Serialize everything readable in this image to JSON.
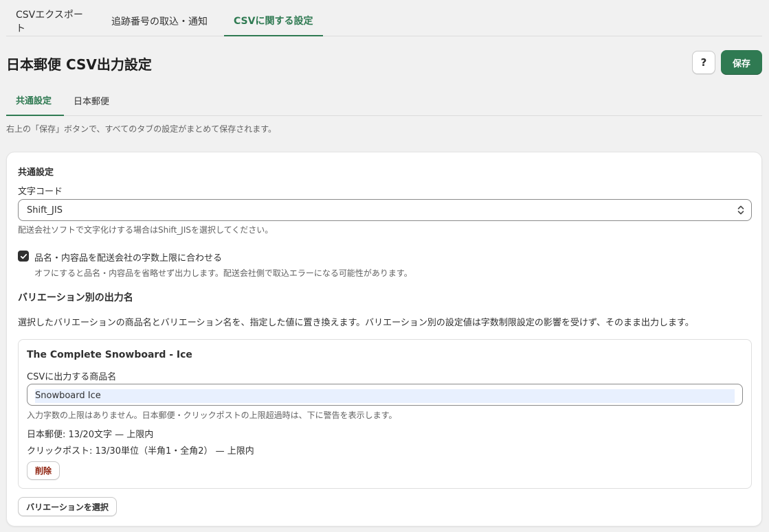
{
  "top_tabs": [
    {
      "label": "CSVエクスポート"
    },
    {
      "label": "追跡番号の取込・通知"
    },
    {
      "label": "CSVに関する設定"
    }
  ],
  "header": {
    "title": "日本郵便 CSV出力設定",
    "help_label": "?",
    "save_label": "保存"
  },
  "sub_tabs": [
    {
      "label": "共通設定"
    },
    {
      "label": "日本郵便"
    }
  ],
  "hint": "右上の「保存」ボタンで、すべてのタブの設定がまとめて保存されます。",
  "common": {
    "section_title": "共通設定",
    "charset_label": "文字コード",
    "charset_value": "Shift_JIS",
    "charset_help": "配送会社ソフトで文字化けする場合はShift_JISを選択してください。",
    "truncate_checked": true,
    "truncate_label": "品名・内容品を配送会社の字数上限に合わせる",
    "truncate_help": "オフにすると品名・内容品を省略せず出力します。配送会社側で取込エラーになる可能性があります。"
  },
  "variants": {
    "title": "バリエーション別の出力名",
    "description": "選択したバリエーションの商品名とバリエーション名を、指定した値に置き換えます。バリエーション別の設定値は字数制限設定の影響を受けず、そのまま出力します。",
    "items": [
      {
        "product": "The Complete Snowboard - Ice",
        "field_label": "CSVに出力する商品名",
        "value": "Snowboard Ice",
        "help": "入力字数の上限はありません。日本郵便・クリックポストの上限超過時は、下に警告を表示します。",
        "japan_post_stat": "日本郵便: 13/20文字 — 上限内",
        "click_post_stat": "クリックポスト: 13/30単位（半角1・全角2） — 上限内",
        "delete_label": "削除"
      }
    ],
    "select_button_label": "バリエーションを選択"
  },
  "colors": {
    "accent": "#2f7a52",
    "danger": "#8e1f0b"
  }
}
